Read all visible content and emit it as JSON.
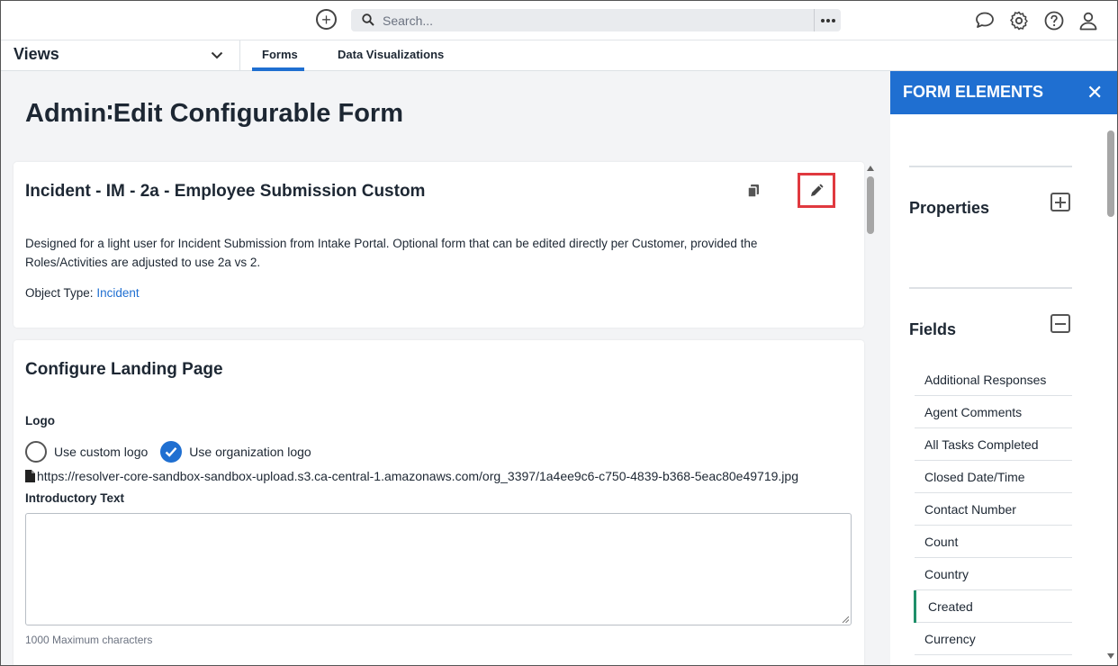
{
  "topbar": {
    "search_placeholder": "Search...",
    "icons": [
      "add-icon",
      "search-icon",
      "more-icon",
      "comment-icon",
      "settings-icon",
      "help-icon",
      "user-icon"
    ]
  },
  "subnav": {
    "views_label": "Views",
    "tabs": [
      {
        "label": "Forms",
        "active": true
      },
      {
        "label": "Data Visualizations",
        "active": false
      }
    ]
  },
  "page": {
    "title_left": "Admin",
    "title_right": "Edit Configurable Form"
  },
  "form": {
    "name": "Incident - IM - 2a - Employee Submission Custom",
    "description": "Designed for a light user for Incident Submission from Intake Portal. Optional form that can be edited directly per Customer, provided the Roles/Activities are adjusted to use 2a vs 2.",
    "object_type_label": "Object Type:",
    "object_type_value": "Incident"
  },
  "landing": {
    "title": "Configure Landing Page",
    "logo_label": "Logo",
    "custom_logo_label": "Use custom logo",
    "org_logo_label": "Use organization logo",
    "selected_option": "Use organization logo",
    "logo_url": "https://resolver-core-sandbox-sandbox-upload.s3.ca-central-1.amazonaws.com/org_3397/1a4ee9c6-c750-4839-b368-5eac80e49719.jpg",
    "intro_label": "Introductory Text",
    "intro_value": "",
    "max_chars": "1000 Maximum characters"
  },
  "panel": {
    "title": "FORM ELEMENTS",
    "properties_label": "Properties",
    "fields_label": "Fields",
    "fields": [
      "Additional Responses",
      "Agent Comments",
      "All Tasks Completed",
      "Closed Date/Time",
      "Contact Number",
      "Count",
      "Country",
      "Created",
      "Currency"
    ],
    "active_field": "Created"
  },
  "colors": {
    "accent": "#1f6fd1",
    "highlight": "#e0393f",
    "active_marker": "#1f8f6a"
  }
}
